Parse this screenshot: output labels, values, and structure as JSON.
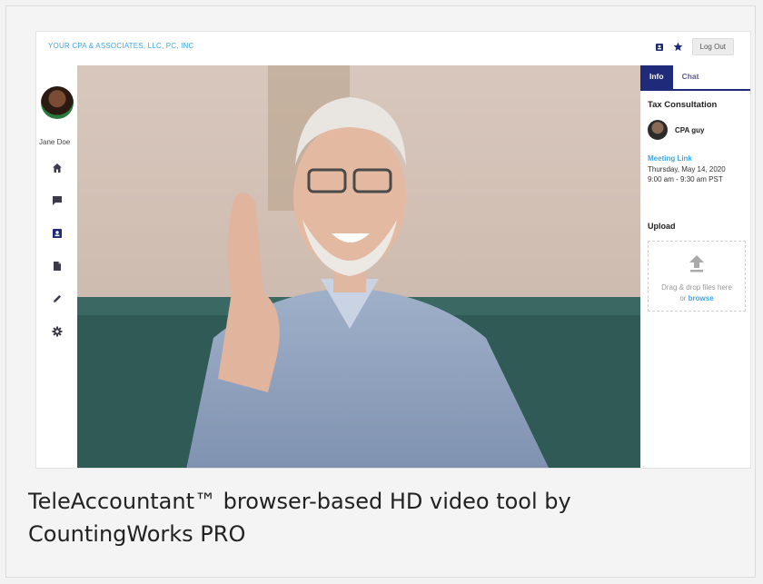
{
  "header": {
    "brand": "YOUR CPA & ASSOCIATES, LLC, PC, INC",
    "logout_label": "Log Out",
    "icons": [
      "contact-card-icon",
      "star-icon"
    ]
  },
  "sidebar": {
    "user_name": "Jane Doe",
    "items": [
      {
        "icon": "home-icon"
      },
      {
        "icon": "chat-icon"
      },
      {
        "icon": "contact-card-icon"
      },
      {
        "icon": "document-icon"
      },
      {
        "icon": "pencil-icon"
      },
      {
        "icon": "gear-icon"
      }
    ]
  },
  "panel": {
    "tabs": [
      {
        "label": "Info"
      },
      {
        "label": "Chat"
      }
    ],
    "title": "Tax Consultation",
    "participant": "CPA guy",
    "meeting_link_label": "Meeting Link",
    "meeting_date": "Thursday, May 14, 2020",
    "meeting_time": "9:00 am - 9:30 am PST",
    "upload_title": "Upload",
    "drop_text": "Drag & drop files here",
    "drop_or": "or",
    "browse_label": "browse"
  },
  "caption": "TeleAccountant™ browser-based HD video tool by CountingWorks PRO",
  "colors": {
    "accent": "#3ea6e6",
    "nav": "#1f2a7a",
    "sidebar_icon": "#3a3a4a"
  }
}
